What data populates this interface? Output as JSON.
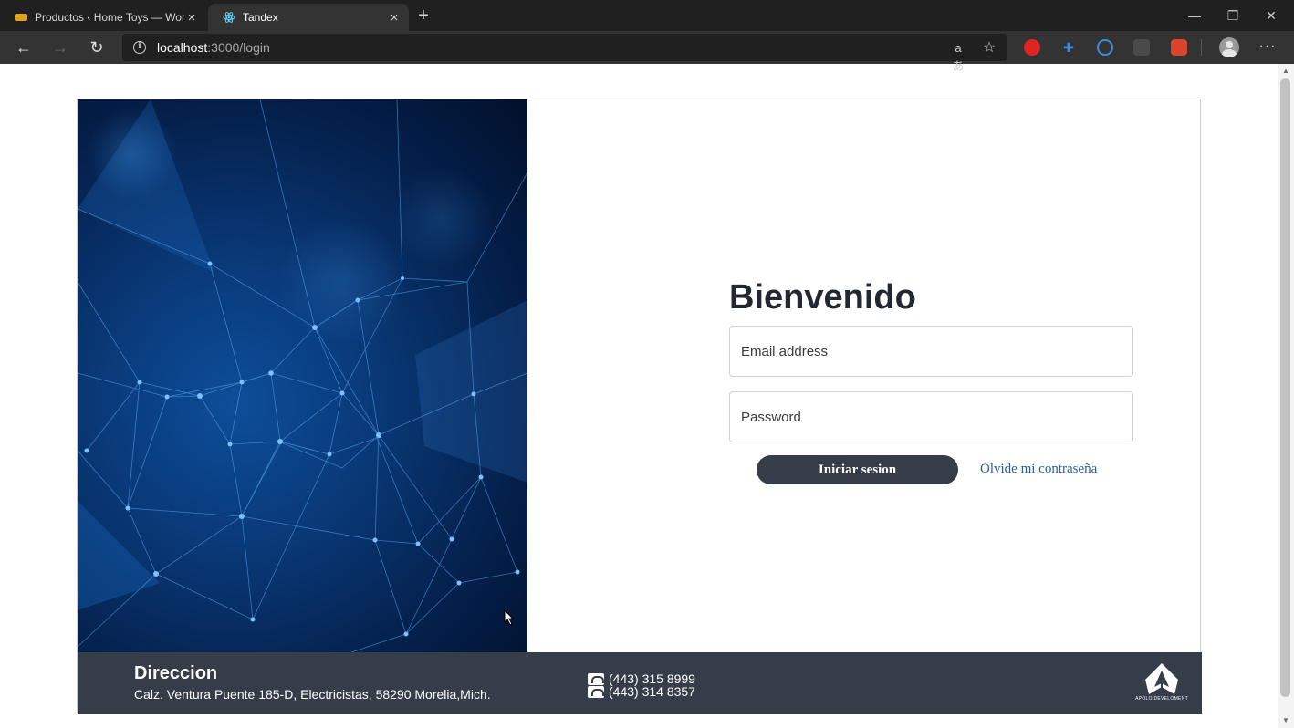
{
  "browser": {
    "tabs": [
      {
        "title": "Productos ‹ Home Toys — WordPress",
        "active": false
      },
      {
        "title": "Tandex",
        "active": true
      }
    ],
    "url_host": "localhost",
    "url_rest": ":3000/login",
    "read_aloud_glyph": "aあ"
  },
  "login": {
    "heading": "Bienvenido",
    "email_placeholder": "Email address",
    "password_placeholder": "Password",
    "submit_label": "Iniciar sesion",
    "forgot_label": "Olvide mi contraseña"
  },
  "footer": {
    "address_title": "Direccion",
    "address": "Calz. Ventura Puente 185-D, Electricistas, 58290 Morelia,Mich.",
    "phones": [
      "(443) 315 8999",
      "(443) 314 8357"
    ],
    "logo_text": "APOLO DEVELOMENT"
  },
  "colors": {
    "footer_bg": "#343d48",
    "button_bg": "#343d48",
    "link": "#2a5c9a",
    "hero_blue": "#0d4e9a"
  }
}
